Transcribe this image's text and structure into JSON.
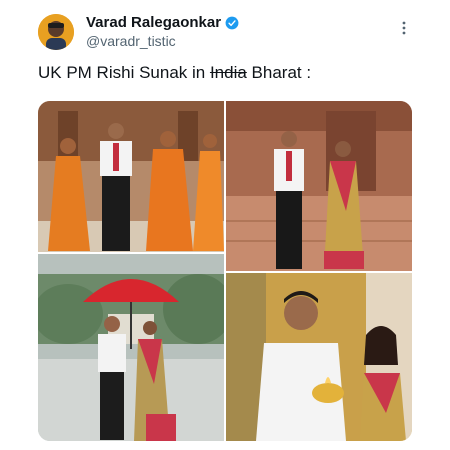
{
  "author": {
    "display_name": "Varad Ralegaonkar",
    "handle": "@varadr_tistic",
    "verified_color": "#1d9bf0",
    "avatar_icon": "profile-avatar"
  },
  "tweet": {
    "text_before": "UK PM Rishi Sunak in ",
    "text_struck": "India",
    "text_after": " Bharat :"
  },
  "menu_icon": "more-options-icon",
  "media": {
    "photos": [
      {
        "name": "temple-photo-with-monks"
      },
      {
        "name": "temple-photo-couple-standing"
      },
      {
        "name": "umbrella-walk-photo"
      },
      {
        "name": "prayer-aarti-photo"
      }
    ]
  }
}
